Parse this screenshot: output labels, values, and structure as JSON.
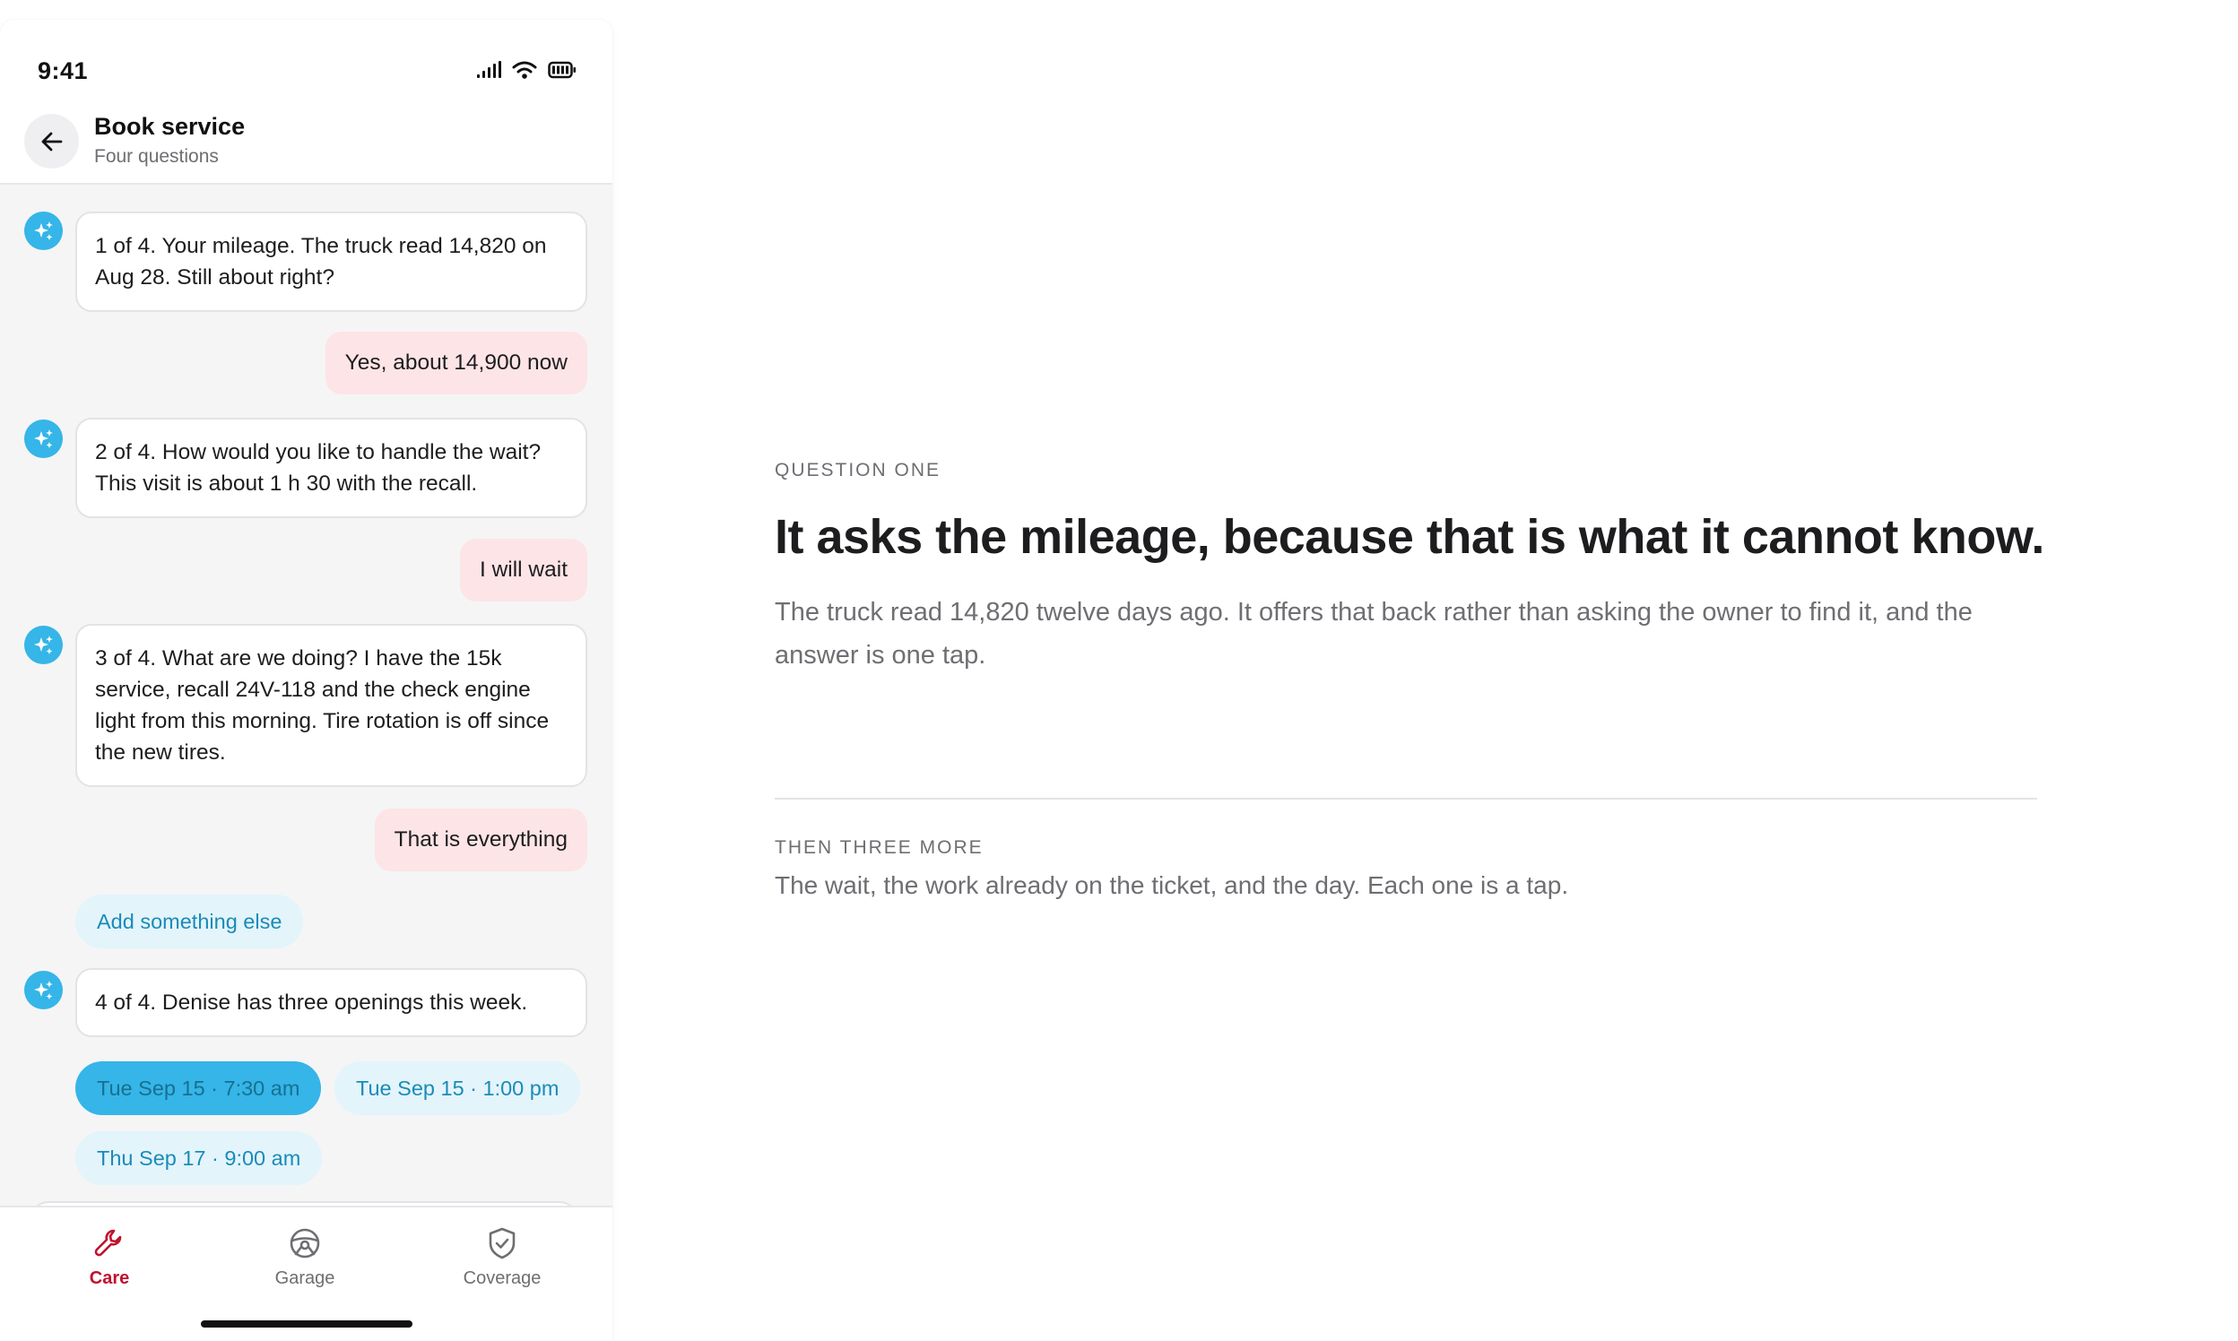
{
  "status_bar": {
    "time": "9:41"
  },
  "header": {
    "title": "Book service",
    "subtitle": "Four questions"
  },
  "chat": {
    "q1": "1 of 4. Your mileage. The truck read 14,820 on Aug 28. Still about right?",
    "a1": "Yes, about 14,900 now",
    "q2": "2 of 4. How would you like to handle the wait? This visit is about 1 h 30 with the recall.",
    "a2": "I will wait",
    "q3": "3 of 4. What are we doing? I have the 15k service, recall 24V-118 and the check engine light from this morning. Tire rotation is off since the new tires.",
    "a3": "That is everything",
    "add_chip": "Add something else",
    "q4": "4 of 4. Denise has three openings this week.",
    "slots": [
      "Tue Sep 15 · 7:30 am",
      "Tue Sep 15 · 1:00 pm",
      "Thu Sep 17 · 9:00 am"
    ],
    "selected_slot": "Tue Sep 15 · 7:30 am"
  },
  "tabbar": {
    "active": "Care",
    "items": [
      {
        "label": "Care",
        "icon": "wrench-icon"
      },
      {
        "label": "Garage",
        "icon": "steering-wheel-icon"
      },
      {
        "label": "Coverage",
        "icon": "shield-check-icon"
      }
    ]
  },
  "content": {
    "eyebrow": "QUESTION ONE",
    "headline": "It asks the mileage, because that is what it cannot know.",
    "body": "The truck read 14,820 twelve days ago. It offers that back rather than asking the owner to find it, and the answer is one tap.",
    "sub_eyebrow": "THEN THREE MORE",
    "sub_body": "The wait, the work already on the ticket, and the day. Each one is a tap."
  },
  "colors": {
    "accent": "#35b5e8",
    "active_tab": "#c0122f",
    "user_bubble": "#fde4e6",
    "chip_bg": "#e3f4fb"
  }
}
